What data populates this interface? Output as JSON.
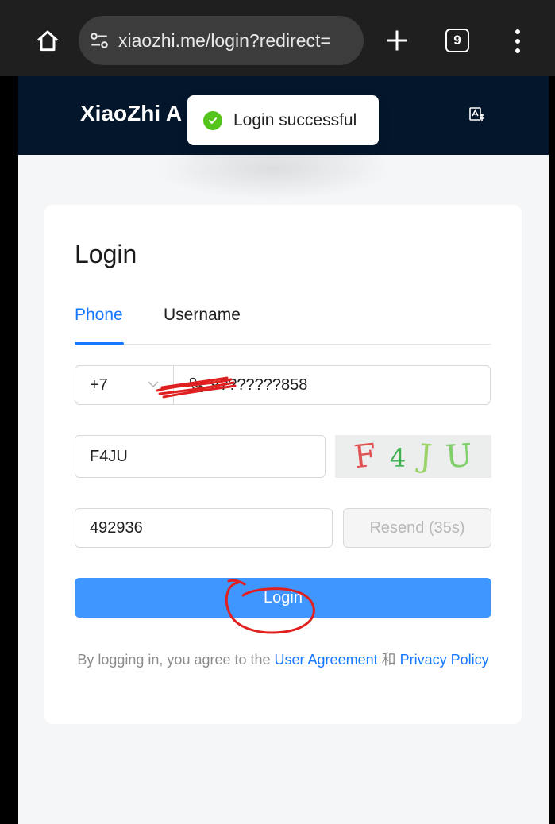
{
  "browser": {
    "url": "xiaozhi.me/login?redirect=",
    "tab_count": "9",
    "icons": [
      "home-icon",
      "site-settings-icon",
      "new-tab-icon",
      "tab-switcher-icon",
      "more-menu-icon"
    ]
  },
  "header": {
    "title": "XiaoZhi A",
    "lang_icon": "translate-icon"
  },
  "toast": {
    "message": "Login successful",
    "icon": "success-check-icon",
    "color": "#52c41a"
  },
  "login": {
    "title": "Login",
    "tabs": [
      {
        "label": "Phone",
        "active": true
      },
      {
        "label": "Username",
        "active": false
      }
    ],
    "country_code": "+7",
    "phone_value": "9???????858",
    "captcha_value": "F4JU",
    "captcha_chars": [
      {
        "char": "F",
        "color": "#e05252"
      },
      {
        "char": "4",
        "color": "#3fb04f"
      },
      {
        "char": "J",
        "color": "#9ad36a"
      },
      {
        "char": "U",
        "color": "#7fd06a"
      }
    ],
    "code_value": "492936",
    "resend_label": "Resend (35s)",
    "submit_label": "Login"
  },
  "agreement": {
    "prefix": "By logging in, you agree to the ",
    "user_agreement": "User Agreement",
    "conjunction": " 和 ",
    "privacy_policy": "Privacy Policy"
  },
  "colors": {
    "accent": "#1677ff",
    "button": "#4096ff",
    "header_bg": "#03162b",
    "annotation": "#e02020"
  }
}
